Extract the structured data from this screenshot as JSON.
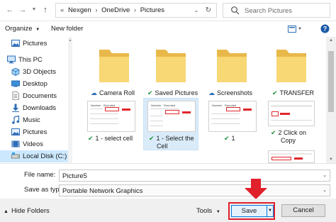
{
  "address_bar": {
    "crumbs": [
      "Nexgen",
      "OneDrive",
      "Pictures"
    ],
    "overflow_chevron": "«",
    "search_placeholder": "Search Pictures"
  },
  "toolbar": {
    "organize_label": "Organize",
    "new_folder_label": "New folder"
  },
  "sidebar": {
    "items": [
      {
        "label": "Pictures",
        "icon": "pictures-icon"
      },
      {
        "label": "This PC",
        "icon": "computer-icon"
      },
      {
        "label": "3D Objects",
        "icon": "3d-objects-icon"
      },
      {
        "label": "Desktop",
        "icon": "desktop-icon"
      },
      {
        "label": "Documents",
        "icon": "documents-icon"
      },
      {
        "label": "Downloads",
        "icon": "downloads-icon"
      },
      {
        "label": "Music",
        "icon": "music-icon"
      },
      {
        "label": "Pictures",
        "icon": "pictures-icon"
      },
      {
        "label": "Videos",
        "icon": "videos-icon"
      },
      {
        "label": "Local Disk (C:)",
        "icon": "drive-icon",
        "selected": true
      }
    ]
  },
  "files": {
    "folders": [
      {
        "name": "Camera Roll",
        "status": "cloud"
      },
      {
        "name": "Saved Pictures",
        "status": "synced"
      },
      {
        "name": "Screenshots",
        "status": "cloud"
      },
      {
        "name": "TRANSFER",
        "status": "synced"
      }
    ],
    "images": [
      {
        "line1": "1 - select cell",
        "line2": "",
        "selected": false
      },
      {
        "line1": "1 - Select the",
        "line2": "Cell",
        "selected": true
      },
      {
        "line1": "1",
        "line2": "",
        "selected": false
      },
      {
        "line1": "2 Click on",
        "line2": "Copy",
        "selected": false
      }
    ],
    "thumb_text": {
      "number": "Number",
      "rounded": "Rounded"
    }
  },
  "save_form": {
    "file_name_label": "File name:",
    "file_name_value": "Picture5",
    "save_type_label": "Save as type:",
    "save_type_value": "Portable Network Graphics"
  },
  "footer": {
    "hide_folders_label": "Hide Folders",
    "tools_label": "Tools",
    "save_label": "Save",
    "cancel_label": "Cancel"
  },
  "colors": {
    "folder_yellow": "#f8d775",
    "folder_dark": "#e8b84a",
    "selection_blue": "#cce8ff",
    "annotation_red": "#e0202a",
    "sync_green": "#1e8f3c",
    "cloud_blue": "#2f6fb8"
  }
}
